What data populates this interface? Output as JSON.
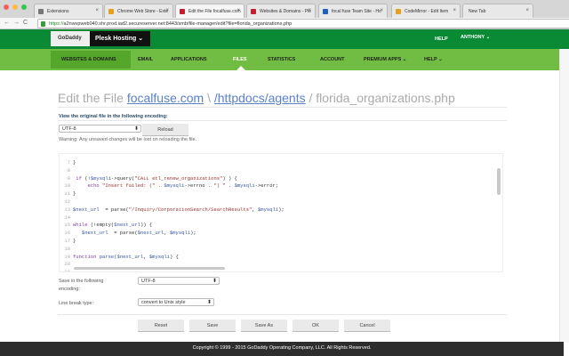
{
  "browser": {
    "tabs": [
      {
        "label": "Extensions",
        "color": "#777"
      },
      {
        "label": "Chrome Web Store - Exte",
        "color": "#e8a020"
      },
      {
        "label": "Edit the File focalfuse.com",
        "color": "#c02030"
      },
      {
        "label": "Websites & Domains - Ple",
        "color": "#c02030"
      },
      {
        "label": "focal fuse Team Site - Ho",
        "color": "#2060c0"
      },
      {
        "label": "CodeMirror - Edit Item",
        "color": "#e8a020"
      },
      {
        "label": "New Tab",
        "color": ""
      }
    ],
    "url_scheme": "https://",
    "url_rest": "a2nwvpweb040.shr.prod.iad2.secureserver.net:8443/smb/file-manager/edit?file=florida_organizations.php"
  },
  "header": {
    "logo": "GoDaddy",
    "product": "Plesk Hosting ⌄",
    "help": "HELP",
    "user": "ANTHONY ⌄"
  },
  "nav": [
    "WEBSITES & DOMAINS",
    "EMAIL",
    "APPLICATIONS",
    "FILES",
    "STATISTICS",
    "ACCOUNT",
    "PREMIUM APPS ⌄",
    "HELP ⌄"
  ],
  "title": {
    "prefix": "Edit the File ",
    "domain": "focalfuse.com",
    "sep1": " \\ ",
    "path": "/httpdocs/agents",
    "sep2": " / ",
    "file": "florida_organizations.php"
  },
  "encoding_section": {
    "heading": "View the original file in the following encoding:",
    "value": "UTF-8",
    "reload": "Reload",
    "warning": "Warning: Any unsaved changes will be lost on reloading the file."
  },
  "code": [
    {
      "n": "7",
      "t": [
        [
          "}",
          "def"
        ]
      ]
    },
    {
      "n": "8",
      "t": []
    },
    {
      "n": "9",
      "t": [
        [
          " if ",
          "kw"
        ],
        [
          "(!",
          "def"
        ],
        [
          "$mysqli",
          "var"
        ],
        [
          "->query(",
          "def"
        ],
        [
          "\"CALL etl_renew_organizations\"",
          "str"
        ],
        [
          ") ) {",
          "def"
        ]
      ]
    },
    {
      "n": "10",
      "t": [
        [
          "     echo ",
          "kw"
        ],
        [
          "\"Insert failed: (\"",
          "str"
        ],
        [
          " . ",
          "def"
        ],
        [
          "$mysqli",
          "var"
        ],
        [
          "->errno . ",
          "def"
        ],
        [
          "\") \"",
          "str"
        ],
        [
          " . ",
          "def"
        ],
        [
          "$mysqli",
          "var"
        ],
        [
          "->error;",
          "def"
        ]
      ]
    },
    {
      "n": "11",
      "t": [
        [
          "}",
          "def"
        ]
      ]
    },
    {
      "n": "12",
      "t": []
    },
    {
      "n": "13",
      "t": [
        [
          "$next_url",
          "var"
        ],
        [
          "  = parse(",
          "def"
        ],
        [
          "\"/Inquiry/CorporationSearch/SearchResults\"",
          "str"
        ],
        [
          ", ",
          "def"
        ],
        [
          "$mysqli",
          "var"
        ],
        [
          ");",
          "def"
        ]
      ]
    },
    {
      "n": "14",
      "t": []
    },
    {
      "n": "15",
      "t": [
        [
          "while ",
          "kw"
        ],
        [
          "(!empty(",
          "def"
        ],
        [
          "$next_url",
          "var"
        ],
        [
          ")) {",
          "def"
        ]
      ]
    },
    {
      "n": "16",
      "t": [
        [
          "   $next_url",
          "var"
        ],
        [
          "  = parse(",
          "def"
        ],
        [
          "$next_url",
          "var"
        ],
        [
          ", ",
          "def"
        ],
        [
          "$mysqli",
          "var"
        ],
        [
          ");",
          "def"
        ]
      ]
    },
    {
      "n": "17",
      "t": [
        [
          "}",
          "def"
        ]
      ]
    },
    {
      "n": "18",
      "t": []
    },
    {
      "n": "19",
      "t": [
        [
          "function ",
          "kw"
        ],
        [
          "parse(",
          "var"
        ],
        [
          "$next_url",
          "var"
        ],
        [
          ", ",
          "def"
        ],
        [
          "$mysqli",
          "var"
        ],
        [
          ") {",
          "def"
        ]
      ]
    },
    {
      "n": "20",
      "t": []
    },
    {
      "n": "21",
      "t": []
    }
  ],
  "save": {
    "enc_label": "Save in the following encoding:",
    "enc_value": "UTF-8",
    "lb_label": "Line break type:",
    "lb_value": "convert to Unix style"
  },
  "buttons": [
    "Reset",
    "Save",
    "Save As",
    "OK",
    "Cancel"
  ],
  "footer": "Copyright © 1999 - 2015 GoDaddy Operating Company, LLC. All Rights Reserved."
}
